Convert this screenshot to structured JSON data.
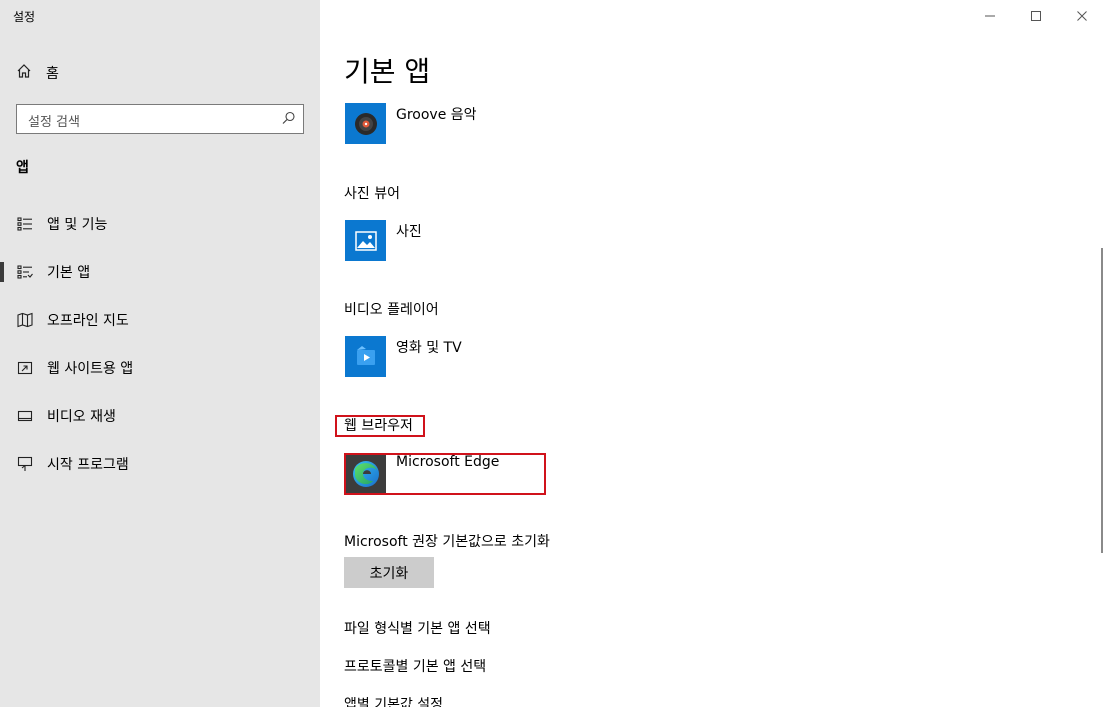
{
  "window": {
    "title": "설정",
    "controls": {
      "minimize": "—",
      "maximize": "☐",
      "close": "✕"
    }
  },
  "sidebar": {
    "home_label": "홈",
    "search_placeholder": "설정 검색",
    "section_title": "앱",
    "items": [
      {
        "label": "앱 및 기능",
        "icon": "apps-features-icon"
      },
      {
        "label": "기본 앱",
        "icon": "default-apps-icon",
        "selected": true
      },
      {
        "label": "오프라인 지도",
        "icon": "offline-maps-icon"
      },
      {
        "label": "웹 사이트용 앱",
        "icon": "apps-for-websites-icon"
      },
      {
        "label": "비디오 재생",
        "icon": "video-playback-icon"
      },
      {
        "label": "시작 프로그램",
        "icon": "startup-icon"
      }
    ]
  },
  "main": {
    "title": "기본 앱",
    "music_app": "Groove 음악",
    "photo_viewer": {
      "heading": "사진 뷰어",
      "app": "사진"
    },
    "video_player": {
      "heading": "비디오 플레이어",
      "app": "영화 및 TV"
    },
    "web_browser": {
      "heading": "웹 브라우저",
      "app": "Microsoft Edge"
    },
    "reset": {
      "label": "Microsoft 권장 기본값으로 초기화",
      "button": "초기화"
    },
    "links": [
      "파일 형식별 기본 앱 선택",
      "프로토콜별 기본 앱 선택",
      "앱별 기본값 설정"
    ]
  },
  "colors": {
    "sidebar_bg": "#e6e6e6",
    "accent_tile": "#0b78d0",
    "highlight": "#d0121b",
    "button_bg": "#cccccc"
  }
}
